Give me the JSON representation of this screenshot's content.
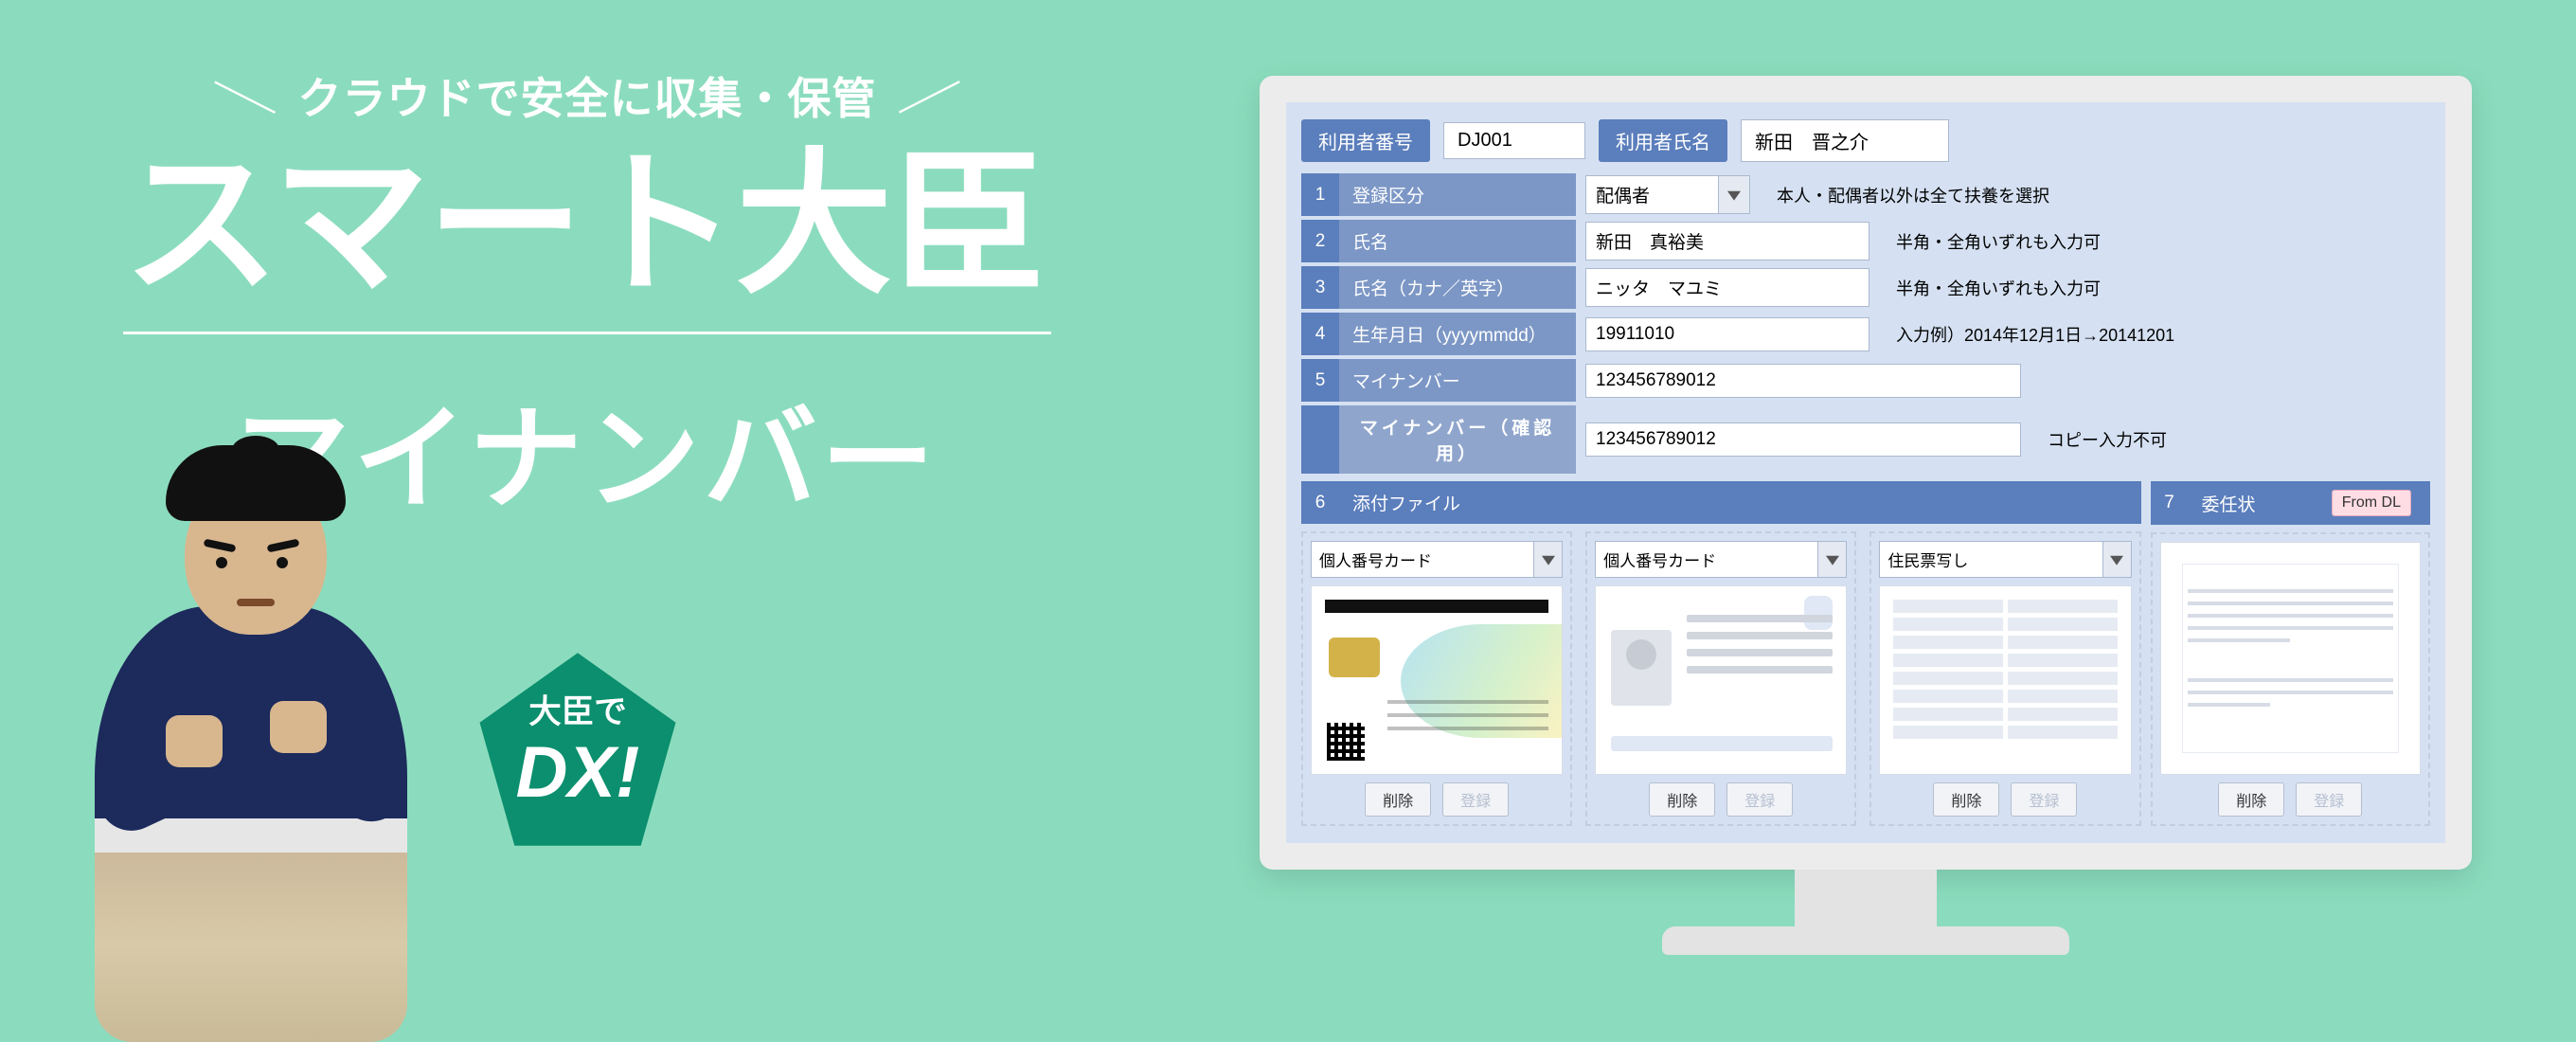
{
  "promo": {
    "tagline": "クラウドで安全に収集・保管",
    "brand": "スマート大臣",
    "sub": "マイナンバー",
    "badge_top": "大臣で",
    "badge_big": "DX!"
  },
  "header": {
    "user_id_label": "利用者番号",
    "user_id_value": "DJ001",
    "user_name_label": "利用者氏名",
    "user_name_value": "新田　晋之介"
  },
  "rows": [
    {
      "n": "1",
      "label": "登録区分",
      "value": "配偶者",
      "hint": "本人・配偶者以外は全て扶養を選択",
      "dropdown": true
    },
    {
      "n": "2",
      "label": "氏名",
      "value": "新田　真裕美",
      "hint": "半角・全角いずれも入力可"
    },
    {
      "n": "3",
      "label": "氏名（カナ／英字）",
      "value": "ニッタ　マユミ",
      "hint": "半角・全角いずれも入力可"
    },
    {
      "n": "4",
      "label": "生年月日（yyyymmdd）",
      "value": "19911010",
      "hint": "入力例）2014年12月1日→20141201"
    },
    {
      "n": "5",
      "label": "マイナンバー",
      "value": "123456789012",
      "hint": ""
    },
    {
      "n": "",
      "label": "マイナンバー（確認用）",
      "value": "123456789012",
      "hint": "コピー入力不可",
      "sub": true
    }
  ],
  "section6": {
    "n": "6",
    "label": "添付ファイル"
  },
  "section7": {
    "n": "7",
    "label": "委任状",
    "tag": "From DL"
  },
  "attachments": {
    "cards": [
      {
        "type": "個人番号カード",
        "kind": "id-front"
      },
      {
        "type": "個人番号カード",
        "kind": "id-back"
      },
      {
        "type": "住民票写し",
        "kind": "resident"
      }
    ],
    "letter": {
      "kind": "letter"
    },
    "btn_delete": "削除",
    "btn_register": "登録"
  }
}
